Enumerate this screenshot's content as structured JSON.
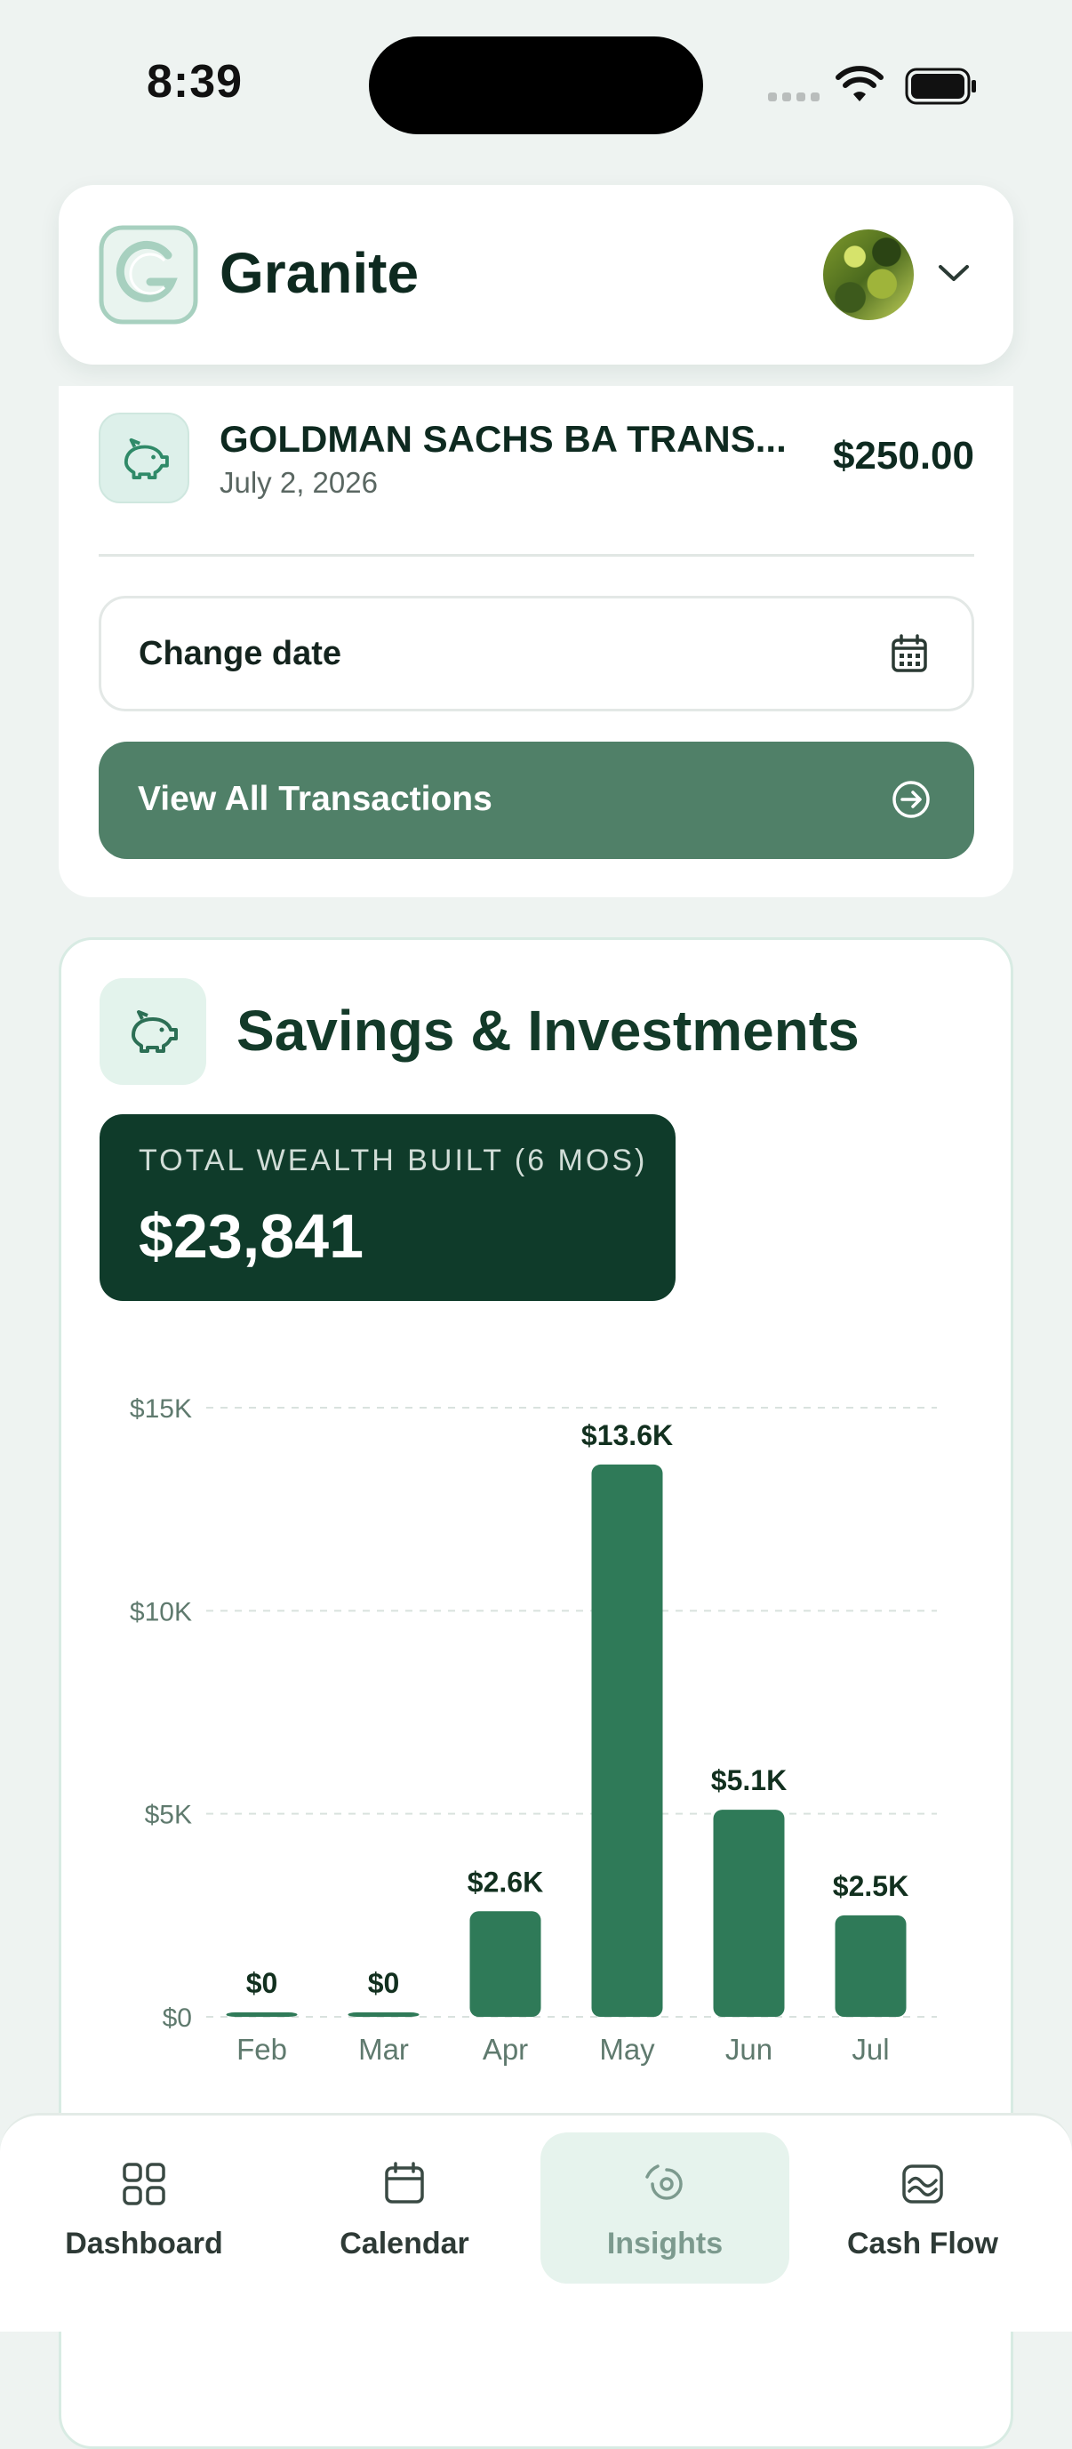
{
  "status_bar": {
    "time": "8:39"
  },
  "header": {
    "brand": "Granite"
  },
  "transaction": {
    "name": "GOLDMAN SACHS BA TRANS...",
    "date": "July 2, 2026",
    "amount": "$250.00"
  },
  "change_date": {
    "label": "Change date"
  },
  "view_all": {
    "label": "View All Transactions"
  },
  "savings": {
    "title": "Savings & Investments",
    "wealth_label": "TOTAL WEALTH BUILT (6 MOS)",
    "wealth_value": "$23,841"
  },
  "chart_data": {
    "type": "bar",
    "categories": [
      "Feb",
      "Mar",
      "Apr",
      "May",
      "Jun",
      "Jul"
    ],
    "values": [
      0,
      0,
      2600,
      13600,
      5100,
      2500
    ],
    "value_labels": [
      "$0",
      "$0",
      "$2.6K",
      "$13.6K",
      "$5.1K",
      "$2.5K"
    ],
    "y_ticks": [
      0,
      5000,
      10000,
      15000
    ],
    "y_tick_labels": [
      "$0",
      "$5K",
      "$10K",
      "$15K"
    ],
    "ylim": [
      0,
      15000
    ],
    "grid": true,
    "bar_color": "#2f7a58"
  },
  "nav": {
    "items": [
      {
        "label": "Dashboard",
        "icon": "grid-icon"
      },
      {
        "label": "Calendar",
        "icon": "calendar-icon"
      },
      {
        "label": "Insights",
        "icon": "insights-icon"
      },
      {
        "label": "Cash Flow",
        "icon": "cash-flow-icon"
      }
    ],
    "active": "Insights"
  },
  "colors": {
    "accent_dark": "#0f3b2a",
    "accent": "#508068",
    "bar": "#2f7a58",
    "background": "#eef3f1"
  }
}
